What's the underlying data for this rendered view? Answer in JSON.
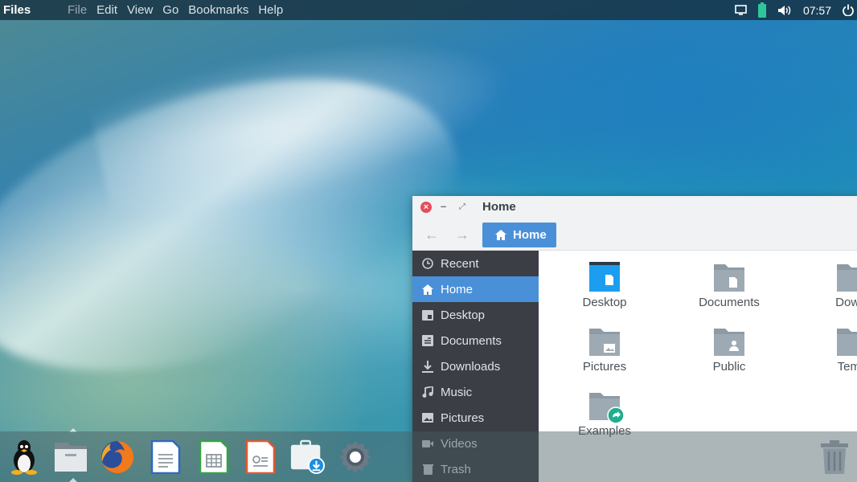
{
  "top_panel": {
    "app_name": "Files",
    "menu": [
      "File",
      "Edit",
      "View",
      "Go",
      "Bookmarks",
      "Help"
    ],
    "clock": "07:57",
    "tray_icons": [
      "display-icon",
      "battery-icon",
      "volume-icon",
      "power-icon"
    ]
  },
  "window": {
    "title": "Home",
    "path_button": "Home",
    "sidebar": [
      {
        "label": "Recent",
        "icon": "clock-icon",
        "active": false
      },
      {
        "label": "Home",
        "icon": "home-icon",
        "active": true
      },
      {
        "label": "Desktop",
        "icon": "desktop-icon",
        "active": false
      },
      {
        "label": "Documents",
        "icon": "document-icon",
        "active": false
      },
      {
        "label": "Downloads",
        "icon": "download-icon",
        "active": false
      },
      {
        "label": "Music",
        "icon": "music-icon",
        "active": false
      },
      {
        "label": "Pictures",
        "icon": "picture-icon",
        "active": false
      },
      {
        "label": "Videos",
        "icon": "video-icon",
        "active": false
      },
      {
        "label": "Trash",
        "icon": "trash-icon",
        "active": false
      }
    ],
    "files": [
      {
        "label": "Desktop",
        "icon": "desktop-folder-icon"
      },
      {
        "label": "Documents",
        "icon": "documents-folder-icon"
      },
      {
        "label": "Downl",
        "icon": "downloads-folder-icon"
      },
      {
        "label": "Pictures",
        "icon": "pictures-folder-icon"
      },
      {
        "label": "Public",
        "icon": "public-folder-icon"
      },
      {
        "label": "Temp",
        "icon": "templates-folder-icon"
      },
      {
        "label": "Examples",
        "icon": "examples-folder-icon"
      }
    ]
  },
  "dock": [
    "tux-icon",
    "files-icon",
    "firefox-icon",
    "writer-icon",
    "calc-icon",
    "impress-icon",
    "store-icon",
    "settings-icon",
    "trash-icon"
  ],
  "colors": {
    "accent": "#4a90d9",
    "sidebar_bg": "#3b3f45",
    "folder": "#8e9ba5",
    "desktop_folder": "#1b9ef0",
    "close": "#e74c5a"
  }
}
